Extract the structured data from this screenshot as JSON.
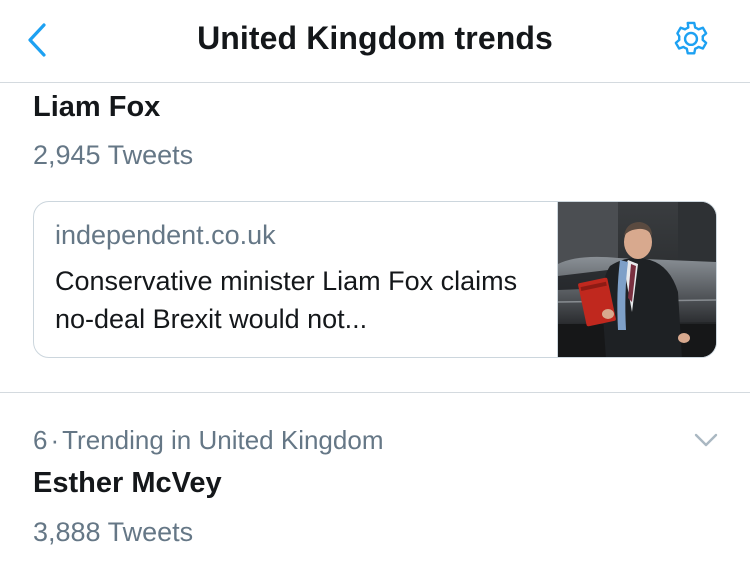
{
  "header": {
    "title": "United Kingdom trends",
    "back_icon": "chevron-left-icon",
    "settings_icon": "gear-icon",
    "accent_color": "#1da1f2"
  },
  "trends": [
    {
      "name": "Liam Fox",
      "tweet_count": "2,945 Tweets",
      "card": {
        "domain": "independent.co.uk",
        "headline": "Conservative minister Liam Fox claims no-deal Brexit would not..."
      }
    },
    {
      "rank": "6",
      "separator": "·",
      "context": "Trending in United Kingdom",
      "name": "Esther McVey",
      "tweet_count": "3,888 Tweets",
      "menu_icon": "chevron-down-icon"
    }
  ]
}
